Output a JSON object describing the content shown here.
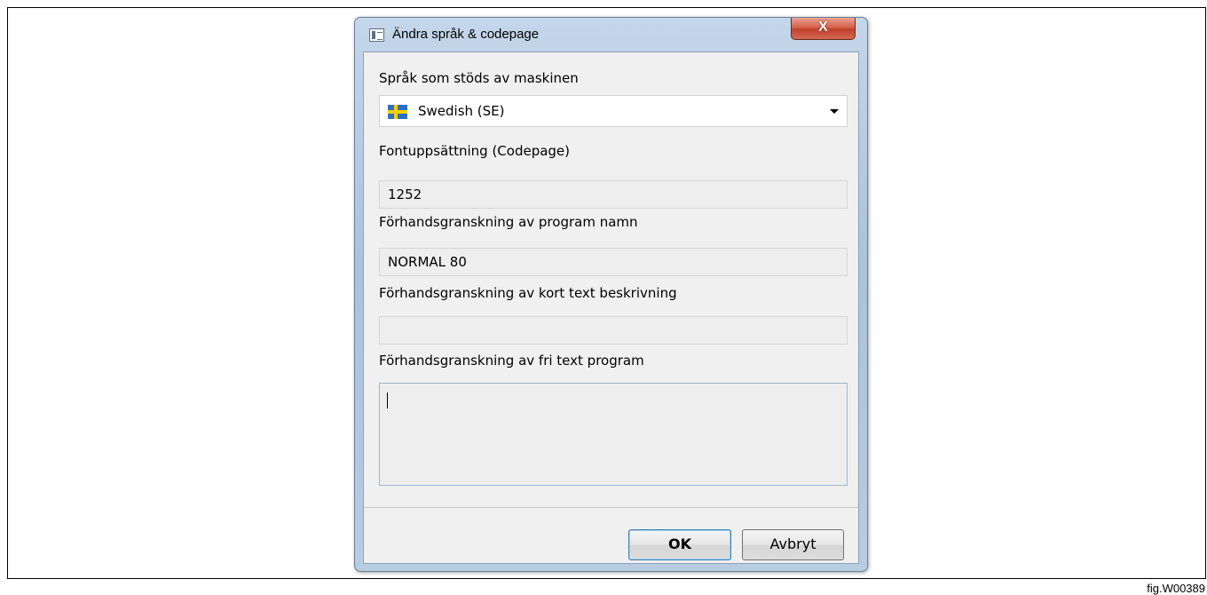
{
  "window": {
    "title": "Ändra språk & codepage",
    "close_glyph": "X"
  },
  "language": {
    "label": "Språk som stöds av maskinen",
    "selected": "Swedish (SE)",
    "flag_icon": "sweden-flag-icon"
  },
  "codepage": {
    "label": "Fontuppsättning (Codepage)",
    "value": "1252"
  },
  "program_name_preview": {
    "label": "Förhandsgranskning av program namn",
    "value": "NORMAL 80"
  },
  "short_text_preview": {
    "label": "Förhandsgranskning av kort text beskrivning",
    "value": ""
  },
  "free_text_preview": {
    "label": "Förhandsgranskning av fri text program",
    "value": ""
  },
  "buttons": {
    "ok": "OK",
    "cancel": "Avbryt"
  },
  "figure_label": "fig.W00389",
  "colors": {
    "titlebar": "#aac2dd",
    "close_button": "#c8452f",
    "client_background": "#f0f0f0"
  }
}
